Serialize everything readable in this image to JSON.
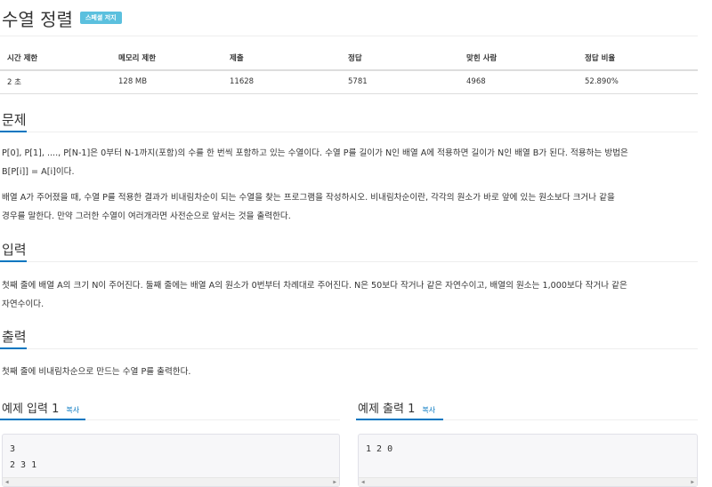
{
  "problem": {
    "title": "수열 정렬",
    "badge": "스페셜 저지"
  },
  "info_table": {
    "headers": [
      "시간 제한",
      "메모리 제한",
      "제출",
      "정답",
      "맞힌 사람",
      "정답 비율"
    ],
    "values": [
      "2 초",
      "128 MB",
      "11628",
      "5781",
      "4968",
      "52.890%"
    ]
  },
  "sections": {
    "problem": {
      "heading": "문제",
      "para1": [
        "P[0], P[1], ...., P[N-1]은 0부터 N-1까지(포함)의 수를 한 번씩 포함하고 있는 수열이다. 수열 P를 길이가 N인 배열 A에 적용하면 길이가 N인 배열 B가 된다. 적용하는 방법은",
        "B[P[i]] = A[i]이다."
      ],
      "para2": [
        "배열 A가 주어졌을 때, 수열 P를 적용한 결과가 비내림차순이 되는 수열을 찾는 프로그램을 작성하시오. 비내림차순이란, 각각의 원소가 바로 앞에 있는 원소보다 크거나 같을",
        "경우를 말한다. 만약 그러한 수열이 여러개라면 사전순으로 앞서는 것을 출력한다."
      ]
    },
    "input": {
      "heading": "입력",
      "para": [
        "첫째 줄에 배열 A의 크기 N이 주어진다. 둘째 줄에는 배열 A의 원소가 0번부터 차례대로 주어진다. N은 50보다 작거나 같은 자연수이고, 배열의 원소는 1,000보다 작거나 같은",
        "자연수이다."
      ]
    },
    "output": {
      "heading": "출력",
      "para": [
        "첫째 줄에 비내림차순으로 만드는 수열 P를 출력한다."
      ]
    }
  },
  "samples": {
    "input": {
      "heading": "예제 입력 1",
      "copy_label": "복사",
      "content": "3\n2 3 1"
    },
    "output": {
      "heading": "예제 출력 1",
      "copy_label": "복사",
      "content": "1 2 0"
    }
  },
  "colors": {
    "accent": "#0076c0",
    "badge": "#5bc0de"
  }
}
